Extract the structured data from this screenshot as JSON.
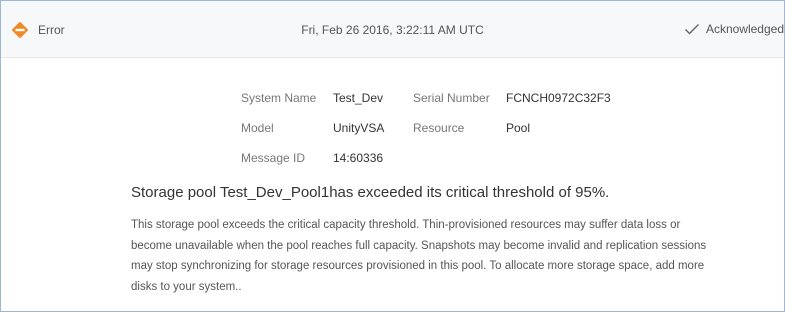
{
  "alert": {
    "severity": "Error",
    "severity_color": "#f08a24",
    "severity_icon": "error-diamond-icon",
    "timestamp": "Fri, Feb 26 2016, 3:22:11 AM UTC",
    "status_icon": "checkmark-icon",
    "status": "Acknowledged"
  },
  "details": {
    "system_name_label": "System Name",
    "system_name": "Test_Dev",
    "serial_number_label": "Serial Number",
    "serial_number": "FCNCH0972C32F3",
    "model_label": "Model",
    "model": "UnityVSA",
    "resource_label": "Resource",
    "resource": "Pool",
    "message_id_label": "Message ID",
    "message_id": "14:60336"
  },
  "message": {
    "title": "Storage pool Test_Dev_Pool1has exceeded its critical threshold of 95%.",
    "description": "This storage pool exceeds the critical capacity threshold. Thin-provisioned resources may suffer data loss or become unavailable when the pool reaches full capacity. Snapshots may become invalid and replication sessions may stop synchronizing for storage resources provisioned in this pool. To allocate more storage space, add more disks to your system.."
  }
}
